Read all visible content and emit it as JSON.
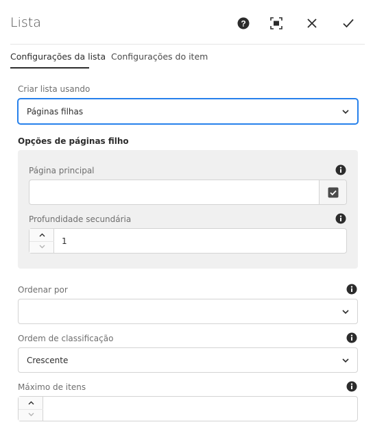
{
  "dialog": {
    "title": "Lista",
    "icons": {
      "help": "help-icon",
      "fullscreen": "fullscreen-icon",
      "close": "close-icon",
      "confirm": "check-icon"
    }
  },
  "tabs": [
    {
      "label": "Configurações da lista",
      "active": true
    },
    {
      "label": "Configurações do item",
      "active": false
    }
  ],
  "form": {
    "build_list": {
      "label": "Criar lista usando",
      "value": "Páginas filhas"
    },
    "child_options": {
      "title": "Opções de páginas filho",
      "parent_page": {
        "label": "Página principal",
        "value": ""
      },
      "child_depth": {
        "label": "Profundidade secundária",
        "value": "1"
      }
    },
    "order_by": {
      "label": "Ordenar por",
      "value": ""
    },
    "sort_order": {
      "label": "Ordem de classificação",
      "value": "Crescente"
    },
    "max_items": {
      "label": "Máximo de itens",
      "value": ""
    }
  },
  "colors": {
    "accent": "#2680eb",
    "panel": "#f0f0f0",
    "text": "#2c2c2c",
    "icon": "#2c2c2c"
  }
}
